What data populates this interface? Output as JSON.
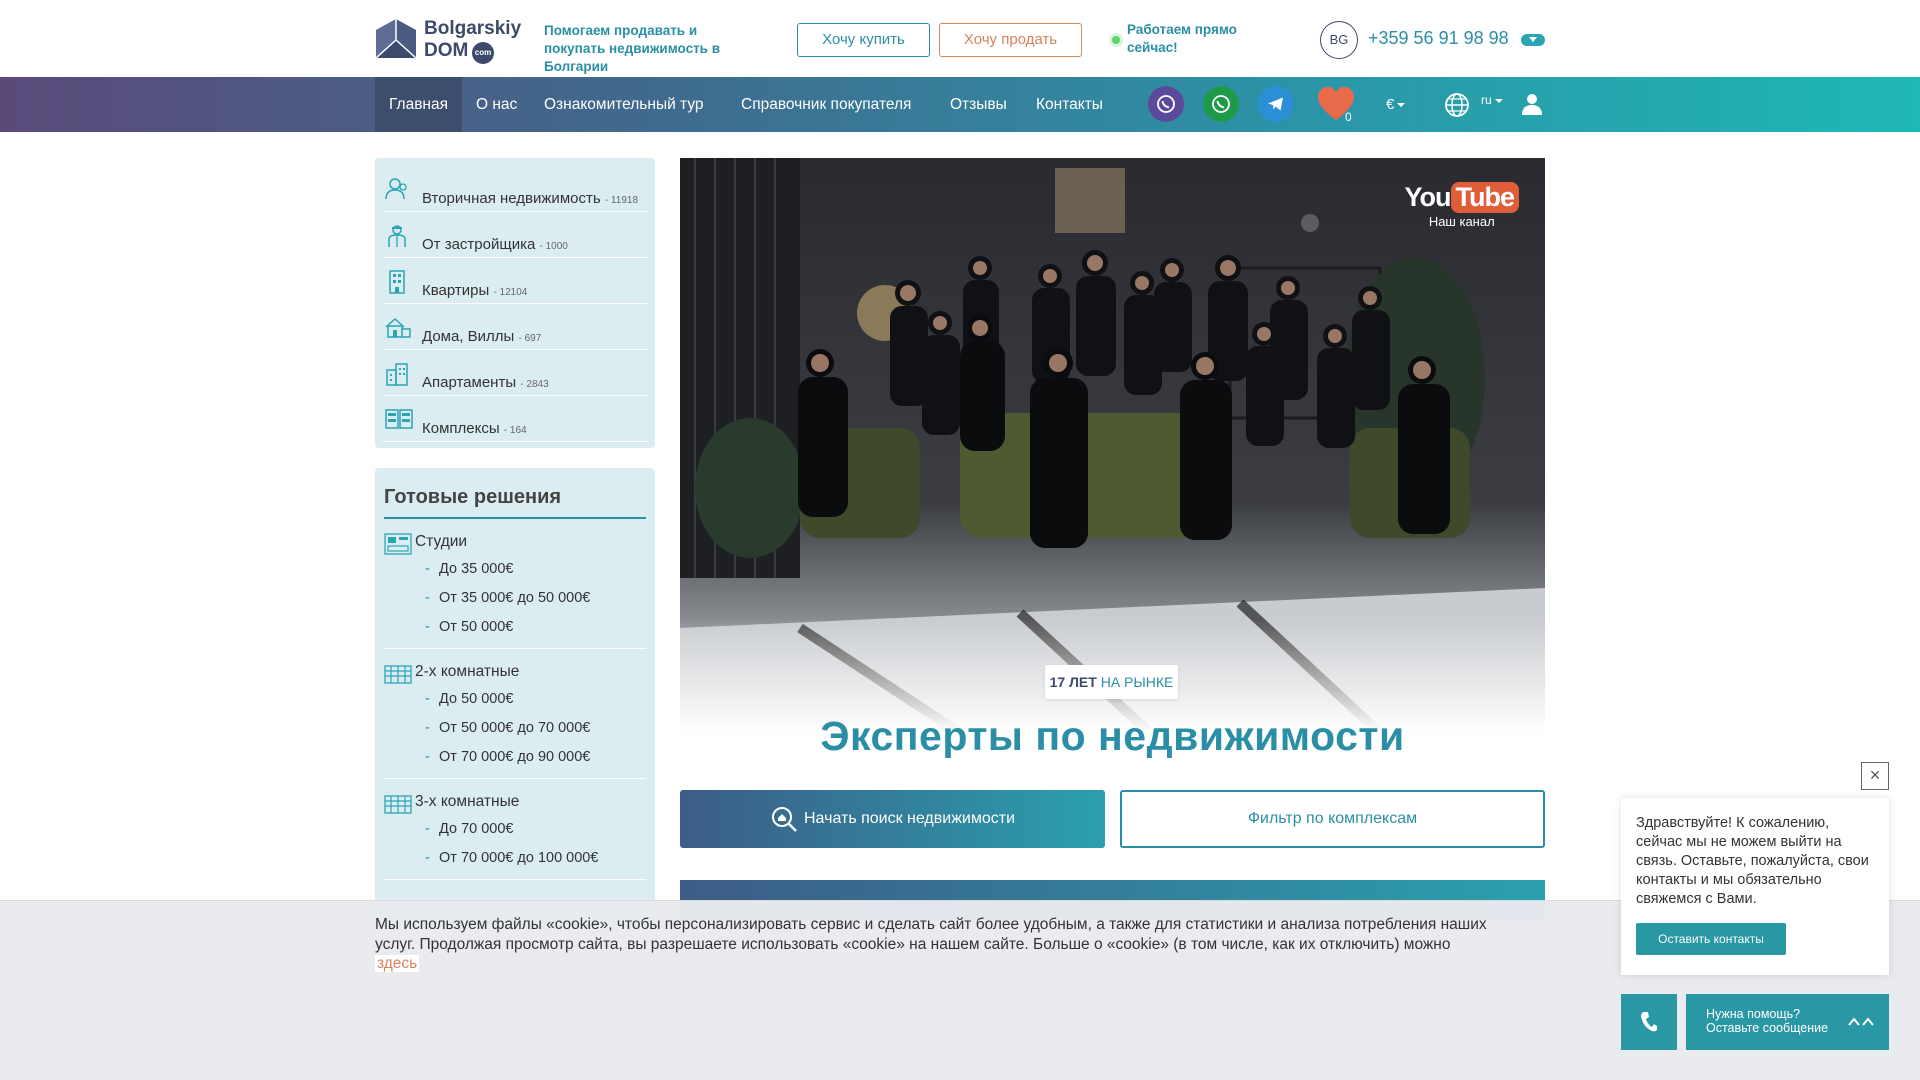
{
  "header": {
    "logo": {
      "name": "Bolgarskiy",
      "dom": "DOM",
      "com": "com"
    },
    "tagline": "Помогаем продавать и покупать недвижимость в Болгарии",
    "buy_label": "Хочу купить",
    "sell_label": "Хочу продать",
    "status": "Работаем прямо сейчас!",
    "lang_code": "BG",
    "phone": "+359 56 91 98 98"
  },
  "nav": {
    "items": [
      {
        "label": "Главная"
      },
      {
        "label": "О нас"
      },
      {
        "label": "Ознакомительный тур"
      },
      {
        "label": "Справочник покупателя"
      },
      {
        "label": "Отзывы"
      },
      {
        "label": "Контакты"
      }
    ],
    "social_icons": [
      "viber-icon",
      "whatsapp-icon",
      "telegram-icon"
    ],
    "favorites_count": "0",
    "currency": "€",
    "language": "ru"
  },
  "sidebar": {
    "categories": [
      {
        "label": "Вторичная недвижимость",
        "count": "- 11918",
        "icon": "people-icon"
      },
      {
        "label": "От застройщика",
        "count": "- 1000",
        "icon": "builder-icon"
      },
      {
        "label": "Квартиры",
        "count": "- 12104",
        "icon": "apartment-building-icon"
      },
      {
        "label": "Дома, Виллы",
        "count": "- 697",
        "icon": "house-icon"
      },
      {
        "label": "Апартаменты",
        "count": "- 2843",
        "icon": "buildings-icon"
      },
      {
        "label": "Комплексы",
        "count": "- 164",
        "icon": "complex-icon"
      }
    ],
    "ready_title": "Готовые решения",
    "groups": [
      {
        "name": "Студии",
        "prices": [
          "До 35 000€",
          "От 35 000€ до 50 000€",
          "От 50 000€"
        ]
      },
      {
        "name": "2-х комнатные",
        "prices": [
          "До 50 000€",
          "От 50 000€ до 70 000€",
          "От 70 000€ до 90 000€"
        ]
      },
      {
        "name": "3-х комнатные",
        "prices": [
          "До 70 000€",
          "От 70 000€ до 100 000€"
        ]
      }
    ]
  },
  "hero": {
    "youtube_you": "You",
    "youtube_tube": "Tube",
    "youtube_caption": "Наш канал",
    "badge_years": "17 ЛЕТ",
    "badge_rest": " НА РЫНКЕ",
    "title": "Эксперты по недвижимости",
    "search_button": "Начать поиск недвижимости",
    "filter_button": "Фильтр по комплексам"
  },
  "cookie": {
    "text": "Мы используем файлы «cookie», чтобы персонализировать сервис и сделать сайт более удобным, а также для статистики и анализа потребления наших услуг. Продолжая просмотр сайта, вы разрешаете использовать «cookie» на нашем сайте. Больше о «cookie» (в том числе, как их отключить) можно ",
    "link": "здесь"
  },
  "chat": {
    "close": "×",
    "message": "Здравствуйте! К сожалению, сейчас мы не можем выйти на связь. Оставьте, пожалуйста, свои контакты и мы обязательно свяжемся с Вами.",
    "button": "Оставить контакты",
    "help_line1": "Нужна помощь?",
    "help_line2": "Оставьте сообщение"
  },
  "colors": {
    "accent": "#2a8fa6",
    "brand_dark": "#3d4a6b",
    "sell": "#d9825b",
    "panel": "#dcedf2"
  }
}
